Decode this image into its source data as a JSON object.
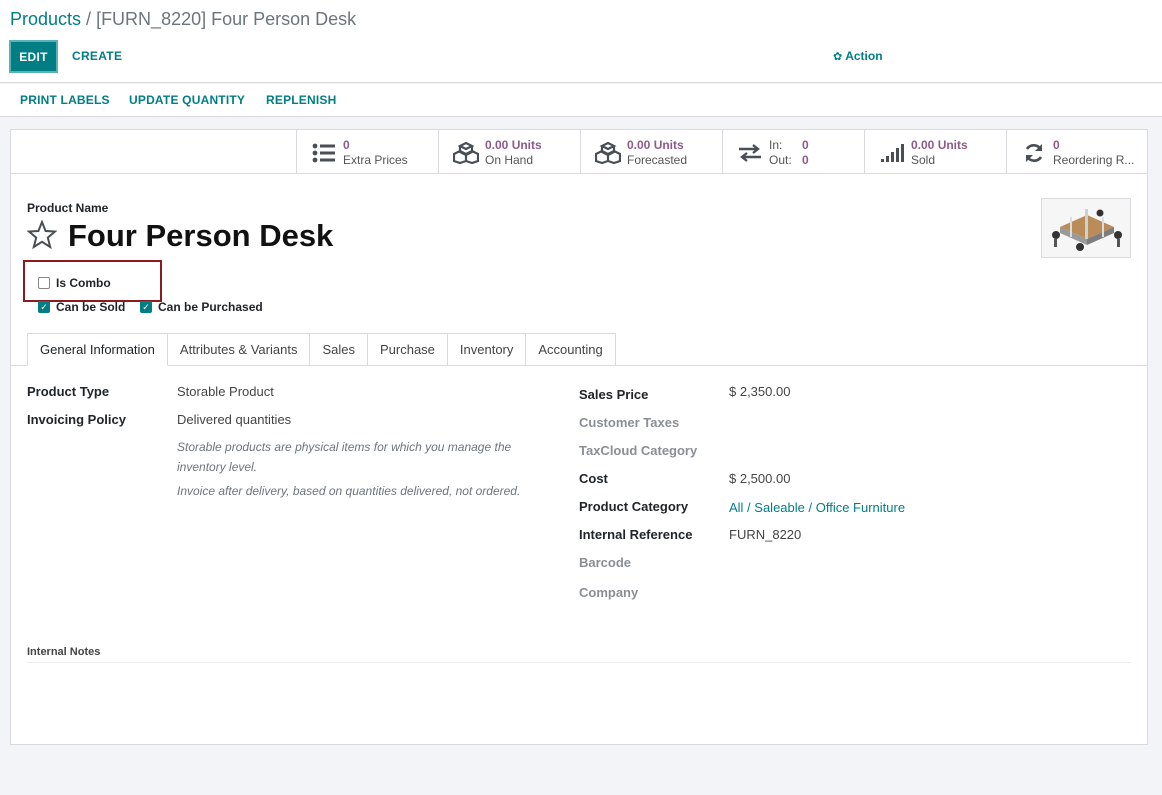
{
  "breadcrumb": {
    "root": "Products",
    "separator": " / ",
    "current": "[FURN_8220] Four Person Desk"
  },
  "control_panel": {
    "edit": "EDIT",
    "create": "CREATE",
    "action": "Action"
  },
  "status_buttons": {
    "print_labels": "PRINT LABELS",
    "update_quantity": "UPDATE QUANTITY",
    "replenish": "REPLENISH"
  },
  "smart_buttons": {
    "extra_prices": {
      "value": "0",
      "label": "Extra Prices",
      "icon": "list-icon"
    },
    "on_hand": {
      "value": "0.00 Units",
      "label": "On Hand",
      "icon": "cubes-icon"
    },
    "forecasted": {
      "value": "0.00 Units",
      "label": "Forecasted",
      "icon": "cubes-icon"
    },
    "in_out": {
      "in_label": "In:",
      "in_value": "0",
      "out_label": "Out:",
      "out_value": "0",
      "icon": "exchange-icon"
    },
    "sold": {
      "value": "0.00 Units",
      "label": "Sold",
      "icon": "signal-icon"
    },
    "reordering": {
      "value": "0",
      "label": "Reordering R...",
      "icon": "refresh-icon"
    }
  },
  "product": {
    "name_label": "Product Name",
    "name": "Four Person Desk",
    "is_combo": {
      "label": "Is Combo",
      "checked": false
    },
    "can_be_sold": {
      "label": "Can be Sold",
      "checked": true
    },
    "can_be_purchased": {
      "label": "Can be Purchased",
      "checked": true
    }
  },
  "tabs": [
    "General Information",
    "Attributes & Variants",
    "Sales",
    "Purchase",
    "Inventory",
    "Accounting"
  ],
  "general": {
    "product_type_label": "Product Type",
    "product_type": "Storable Product",
    "invoicing_policy_label": "Invoicing Policy",
    "invoicing_policy": "Delivered quantities",
    "help_storable": "Storable products are physical items for which you manage the inventory level.",
    "help_invoice": "Invoice after delivery, based on quantities delivered, not ordered.",
    "sales_price_label": "Sales Price",
    "sales_price": "$ 2,350.00",
    "customer_taxes_label": "Customer Taxes",
    "taxcloud_label": "TaxCloud Category",
    "cost_label": "Cost",
    "cost": "$ 2,500.00",
    "category_label": "Product Category",
    "category": "All / Saleable / Office Furniture",
    "internal_ref_label": "Internal Reference",
    "internal_ref": "FURN_8220",
    "barcode_label": "Barcode",
    "company_label": "Company",
    "internal_notes_label": "Internal Notes"
  },
  "colors": {
    "primary": "#017e84",
    "stat_value": "#8f5a89",
    "highlight_border": "#8b1b1f"
  }
}
